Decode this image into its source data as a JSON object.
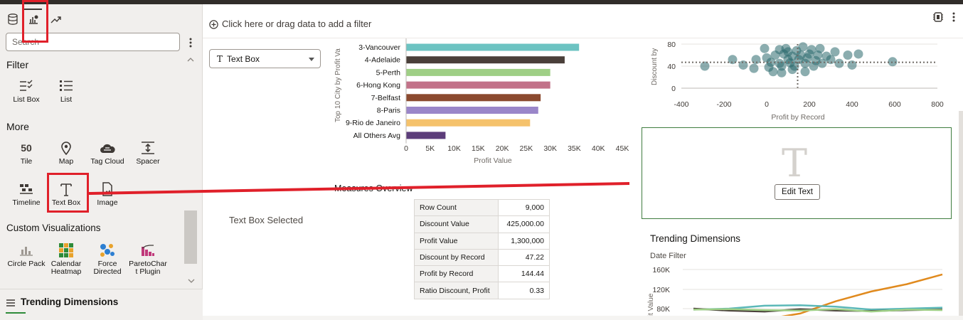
{
  "sidebar": {
    "search_placeholder": "Search",
    "filter_section": "Filter",
    "filter_items": [
      {
        "label": "List Box"
      },
      {
        "label": "List"
      }
    ],
    "more_section": "More",
    "more_items": [
      {
        "label": "Tile",
        "glyph": "50"
      },
      {
        "label": "Map"
      },
      {
        "label": "Tag Cloud"
      },
      {
        "label": "Spacer"
      },
      {
        "label": "Timeline"
      },
      {
        "label": "Text Box"
      },
      {
        "label": "Image"
      }
    ],
    "custom_section": "Custom Visualizations",
    "custom_items": [
      {
        "label": "Circle Pack"
      },
      {
        "label": "Calendar Heatmap"
      },
      {
        "label": "Force Directed"
      },
      {
        "label": "ParetoChar t Plugin"
      }
    ],
    "bottom_title": "Trending Dimensions"
  },
  "filterbar": {
    "text": "Click here or drag data to add a filter"
  },
  "canvas": {
    "select_value": "Text Box",
    "select_icon": "T",
    "note": "Text Box Selected",
    "measures_title": "Measures Overview",
    "measures": [
      {
        "key": "Row Count",
        "value": "9,000"
      },
      {
        "key": "Discount Value",
        "value": "425,000.00"
      },
      {
        "key": "Profit Value",
        "value": "1,300,000"
      },
      {
        "key": "Discount by Record",
        "value": "47.22"
      },
      {
        "key": "Profit by Record",
        "value": "144.44"
      },
      {
        "key": "Ratio Discount, Profit",
        "value": "0.33"
      }
    ],
    "textbox_glyph": "T",
    "edit_text_label": "Edit Text",
    "trending_title": "Trending Dimensions",
    "date_filter": "Date Filter"
  },
  "colors": {
    "highlight": "#e0202a",
    "panel_border": "#3f7d3f"
  },
  "chart_data": [
    {
      "type": "bar",
      "orientation": "horizontal",
      "categories": [
        "3-Vancouver",
        "4-Adelaide",
        "5-Perth",
        "6-Hong Kong",
        "7-Belfast",
        "8-Paris",
        "9-Rio de Janeiro",
        "All Others Avg"
      ],
      "category_labels": [
        "3-Vancouver",
        "4-Adelaide",
        "5-Perth",
        "6-Hong Kong",
        "7-Belfast",
        "8-Paris",
        "9-Rio de Janeiro",
        "All Others Avg"
      ],
      "values": [
        36000,
        33000,
        30000,
        30000,
        28000,
        27500,
        25800,
        8200
      ],
      "colors": [
        "#6cc3c2",
        "#4a3f3a",
        "#9fcf86",
        "#c27289",
        "#8b4a2f",
        "#9a86c9",
        "#f5c26c",
        "#5c3d7a"
      ],
      "xlabel": "Profit Value",
      "ylabel": "Top 10 City by Profit Va",
      "xlim": [
        0,
        45000
      ],
      "xticks": [
        "0",
        "5K",
        "10K",
        "15K",
        "20K",
        "25K",
        "30K",
        "35K",
        "40K",
        "45K"
      ]
    },
    {
      "type": "scatter",
      "xlabel": "Profit by Record",
      "ylabel": "Discount by",
      "xlim": [
        -400,
        800
      ],
      "ylim": [
        0,
        80
      ],
      "xticks": [
        "-400",
        "-200",
        "0",
        "200",
        "400",
        "600",
        "800"
      ],
      "yticks": [
        "0",
        "40",
        "80"
      ],
      "reference_x": 145,
      "reference_y": 47,
      "points": [
        [
          -290,
          40
        ],
        [
          -160,
          52
        ],
        [
          -110,
          42
        ],
        [
          -50,
          52
        ],
        [
          -10,
          72
        ],
        [
          0,
          55
        ],
        [
          10,
          38
        ],
        [
          20,
          47
        ],
        [
          40,
          60
        ],
        [
          60,
          45
        ],
        [
          70,
          40
        ],
        [
          80,
          62
        ],
        [
          90,
          72
        ],
        [
          100,
          52
        ],
        [
          110,
          46
        ],
        [
          120,
          58
        ],
        [
          130,
          40
        ],
        [
          140,
          68
        ],
        [
          150,
          52
        ],
        [
          160,
          60
        ],
        [
          170,
          75
        ],
        [
          180,
          45
        ],
        [
          190,
          55
        ],
        [
          200,
          62
        ],
        [
          210,
          70
        ],
        [
          230,
          50
        ],
        [
          240,
          60
        ],
        [
          250,
          72
        ],
        [
          260,
          45
        ],
        [
          280,
          58
        ],
        [
          300,
          52
        ],
        [
          320,
          66
        ],
        [
          340,
          45
        ],
        [
          380,
          60
        ],
        [
          400,
          42
        ],
        [
          430,
          62
        ],
        [
          590,
          48
        ],
        [
          -60,
          36
        ],
        [
          30,
          30
        ],
        [
          70,
          28
        ],
        [
          120,
          34
        ],
        [
          100,
          66
        ],
        [
          60,
          70
        ],
        [
          220,
          40
        ],
        [
          180,
          30
        ]
      ]
    },
    {
      "type": "line",
      "ylabel": "fit Value",
      "yticks": [
        "80K",
        "120K",
        "160K"
      ],
      "ylim": [
        60000,
        170000
      ],
      "series": [
        {
          "color": "#e08a1e",
          "values": [
            62000,
            60000,
            58000,
            70000,
            95000,
            115000,
            130000,
            150000
          ]
        },
        {
          "color": "#5bb8b8",
          "values": [
            78000,
            80000,
            86000,
            87000,
            84000,
            78000,
            80000,
            82000
          ]
        },
        {
          "color": "#4a3f3a",
          "values": [
            80000,
            76000,
            74000,
            79000,
            76000,
            75000,
            77000,
            78000
          ]
        },
        {
          "color": "#9fcf86",
          "values": [
            78000,
            79000,
            77000,
            76000,
            79000,
            74000,
            78000,
            77000
          ]
        }
      ]
    }
  ]
}
